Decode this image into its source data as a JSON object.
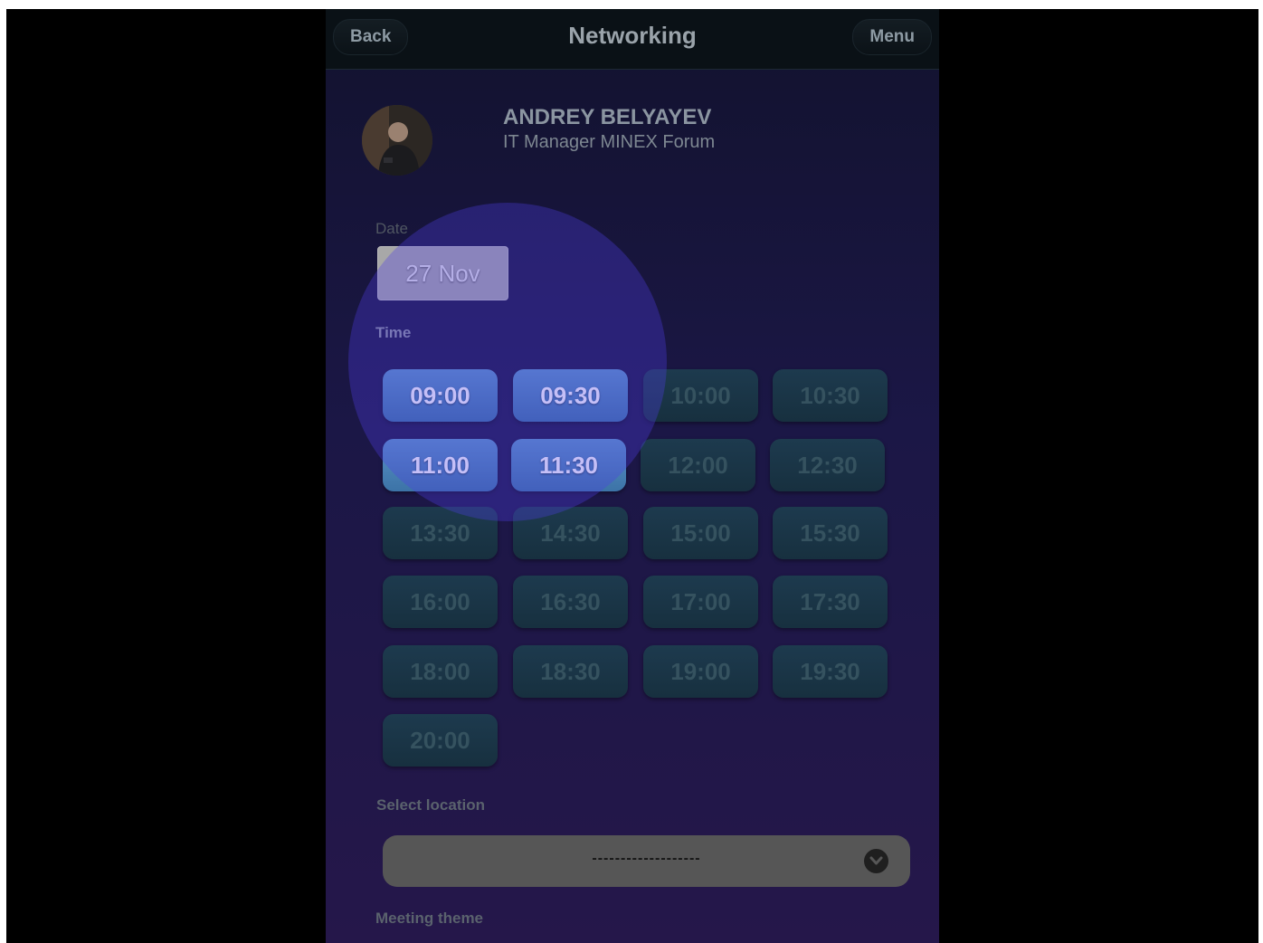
{
  "header": {
    "back_label": "Back",
    "title": "Networking",
    "menu_label": "Menu"
  },
  "profile": {
    "name": "ANDREY BELYAYEV",
    "role": "IT Manager MINEX Forum"
  },
  "date": {
    "label": "Date",
    "value": "27 Nov"
  },
  "time": {
    "label": "Time",
    "slots": [
      {
        "label": "09:00",
        "available": true
      },
      {
        "label": "09:30",
        "available": true
      },
      {
        "label": "10:00",
        "available": false
      },
      {
        "label": "10:30",
        "available": false
      },
      {
        "label": "11:00",
        "available": true
      },
      {
        "label": "11:30",
        "available": true
      },
      {
        "label": "12:00",
        "available": false
      },
      {
        "label": "12:30",
        "available": false
      },
      {
        "label": "13:30",
        "available": false
      },
      {
        "label": "14:30",
        "available": false
      },
      {
        "label": "15:00",
        "available": false
      },
      {
        "label": "15:30",
        "available": false
      },
      {
        "label": "16:00",
        "available": false
      },
      {
        "label": "16:30",
        "available": false
      },
      {
        "label": "17:00",
        "available": false
      },
      {
        "label": "17:30",
        "available": false
      },
      {
        "label": "18:00",
        "available": false
      },
      {
        "label": "18:30",
        "available": false
      },
      {
        "label": "19:00",
        "available": false
      },
      {
        "label": "19:30",
        "available": false
      },
      {
        "label": "20:00",
        "available": false
      }
    ]
  },
  "location": {
    "label": "Select location",
    "value": "-------------------"
  },
  "meeting_theme": {
    "label": "Meeting theme"
  },
  "colors": {
    "active_slot": "#4a83b8",
    "inactive_slot": "#1b3547",
    "spotlight": "#5a3ce6"
  }
}
